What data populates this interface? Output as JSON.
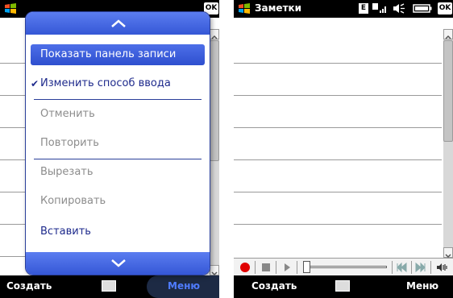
{
  "left_screen": {
    "title_ok": "OK",
    "popup": {
      "items": [
        {
          "label": "Показать панель записи",
          "state": "selected"
        },
        {
          "label": "Изменить способ ввода",
          "state": "checked"
        },
        {
          "label": "Отменить",
          "state": "disabled"
        },
        {
          "label": "Повторить",
          "state": "disabled"
        },
        {
          "label": "Вырезать",
          "state": "disabled"
        },
        {
          "label": "Копировать",
          "state": "disabled"
        },
        {
          "label": "Вставить",
          "state": "enabled"
        }
      ]
    },
    "softkeys": {
      "left": "Создать",
      "right": "Меню"
    }
  },
  "right_screen": {
    "app_title": "Заметки",
    "status_network": "E",
    "title_ok": "OK",
    "softkeys": {
      "left": "Создать",
      "right": "Меню"
    }
  },
  "colors": {
    "accent": "#3557d6",
    "menu_text": "#1e2a8c",
    "disabled_text": "#8c8c8c",
    "title_bar": "#000000",
    "record_red": "#e00000"
  }
}
